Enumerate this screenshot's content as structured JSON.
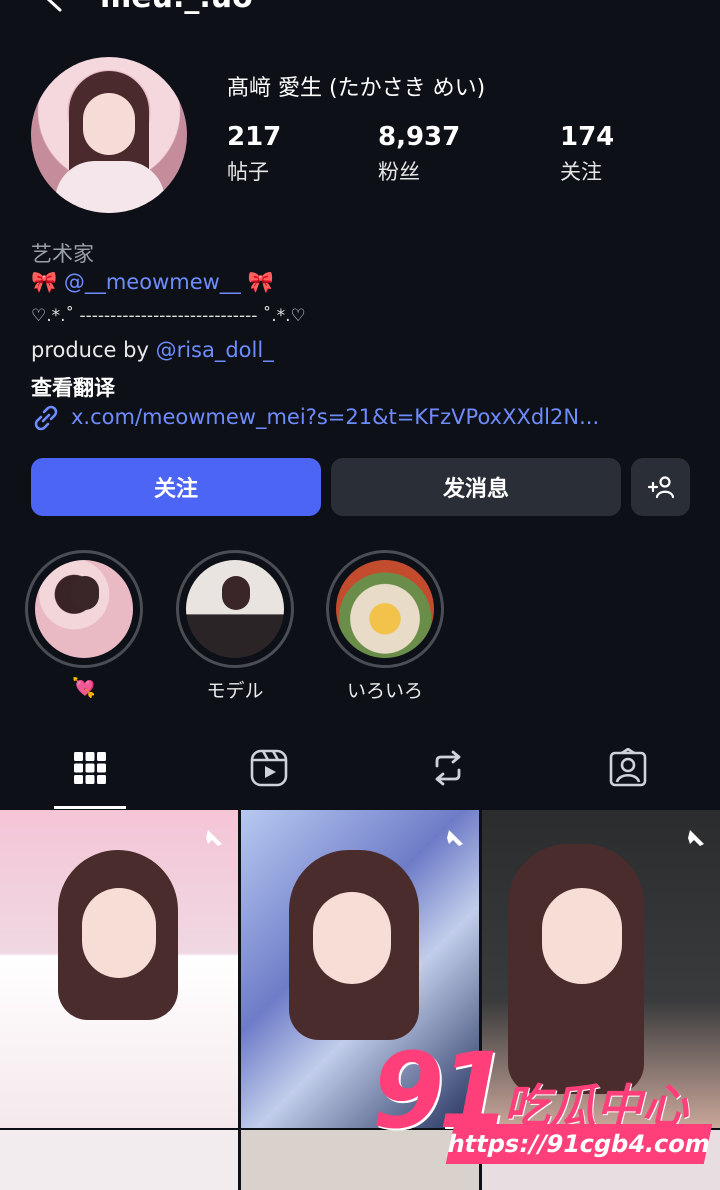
{
  "header": {
    "username": "meu._.uo"
  },
  "profile": {
    "full_name": "髙﨑 愛生 (たかさき めい)",
    "stats": [
      {
        "value": "217",
        "label": "帖子"
      },
      {
        "value": "8,937",
        "label": "粉丝"
      },
      {
        "value": "174",
        "label": "关注"
      }
    ]
  },
  "bio": {
    "category": "艺术家",
    "line1_bow_left": "🎀",
    "line1_handle": "@__meowmew__",
    "line1_bow_right": "🎀",
    "line2": "♡.*.˚ ----------------------------- ˚.*.♡",
    "line3_prefix": "produce by ",
    "line3_mention": "@risa_doll_",
    "translate": "查看翻译",
    "link": "x.com/meowmew_mei?s=21&t=KFzVPoxXXdl2N..."
  },
  "actions": {
    "follow": "关注",
    "message": "发消息"
  },
  "highlights": [
    {
      "label": "💘"
    },
    {
      "label": "モデル"
    },
    {
      "label": "いろいろ"
    }
  ],
  "watermark": {
    "number": "91",
    "title": "吃瓜中心",
    "url": "https://91cgb4.com"
  },
  "colors": {
    "accent": "#4d65f5",
    "link": "#6f8cff",
    "background": "#0d1017",
    "watermark": "#ff3f7a"
  },
  "icons": {
    "back": "back-arrow-icon",
    "link": "link-icon",
    "suggest": "add-person-icon",
    "tab_posts": "grid-icon",
    "tab_reels": "reels-icon",
    "tab_reposts": "repost-icon",
    "tab_tagged": "tagged-person-icon",
    "pin": "pin-icon"
  }
}
